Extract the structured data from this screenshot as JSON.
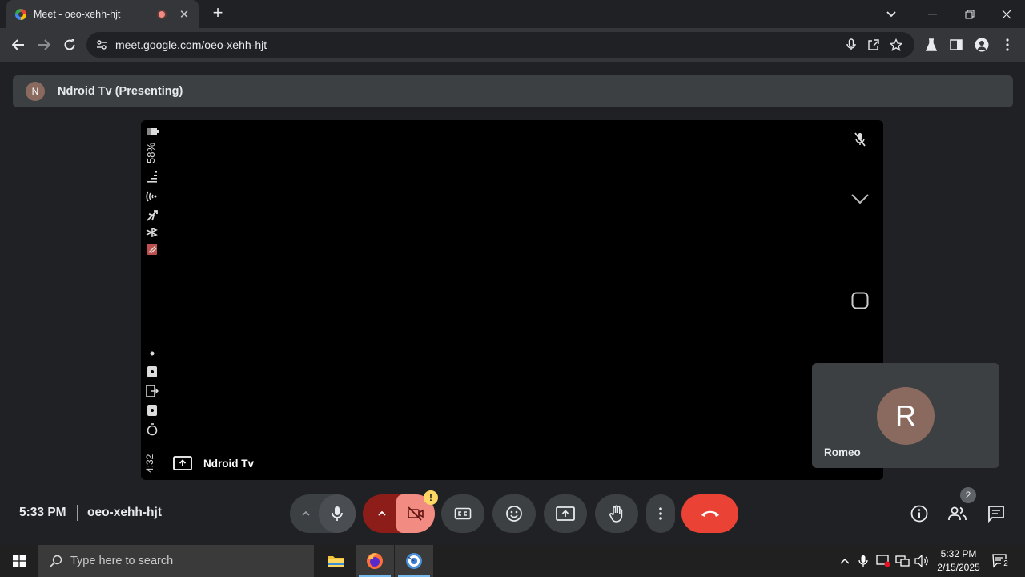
{
  "browser": {
    "tab_title": "Meet - oeo-xehh-hjt",
    "tab_close": "✕",
    "new_tab": "+",
    "url": "meet.google.com/oeo-xehh-hjt"
  },
  "meet": {
    "presenting_avatar": "N",
    "presenting_banner": "Ndroid Tv (Presenting)",
    "screen_battery": "58%",
    "screen_clock": "4:32",
    "presenter_name": "Ndroid Tv",
    "participant_initial": "R",
    "participant_name": "Romeo",
    "time": "5:33 PM",
    "meeting_code": "oeo-xehh-hjt",
    "camera_warning": "!",
    "participant_count": "2",
    "colors": {
      "end_call": "#ea4335",
      "camera_off": "#f28b82",
      "camera_arrow_bg": "#8c1d18",
      "warning": "#fdd663",
      "avatar": "#8a6a5e"
    }
  },
  "taskbar": {
    "search_placeholder": "Type here to search",
    "clock_time": "5:32 PM",
    "clock_date": "2/15/2025",
    "notification_count": "2"
  }
}
